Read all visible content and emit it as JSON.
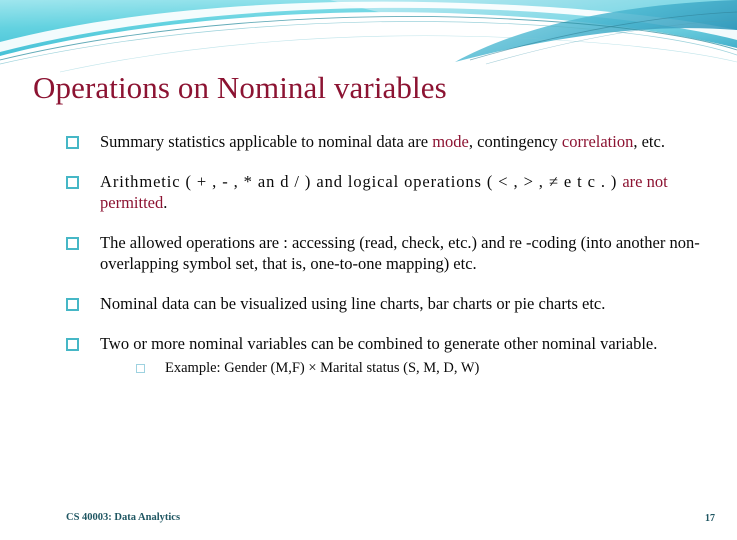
{
  "slide": {
    "title": "Operations on Nominal variables",
    "accent_color": "#8C1332",
    "bullet_color": "#46B7C6",
    "footer_color": "#1F5662",
    "header_gradient_start": "#6FD8E4",
    "header_gradient_end": "#3FA9C4"
  },
  "bullets": [
    {
      "marker": "hollow-square",
      "parts": [
        {
          "text": "Summary  statistics  applicable  to  nominal  data  are  ",
          "style": "normal"
        },
        {
          "text": "mode",
          "style": "accent"
        },
        {
          "text": ", contingency ",
          "style": "normal"
        },
        {
          "text": "correlation",
          "style": "accent"
        },
        {
          "text": ", etc.",
          "style": "normal"
        }
      ]
    },
    {
      "marker": "hollow-square",
      "parts": [
        {
          "text": "Arithmetic ( + , - , * an d / )  and logical operations ( < , > , ≠  e t c . ) ",
          "style": "ops"
        },
        {
          "text": "are not permitted",
          "style": "accent"
        },
        {
          "text": ".",
          "style": "normal"
        }
      ]
    },
    {
      "marker": "hollow-square",
      "parts": [
        {
          "text": "The allowed operations are : accessing (read, check, etc.) and re -coding (into another non-overlapping symbol set, that is,  one-to-one mapping) etc.",
          "style": "normal"
        }
      ]
    },
    {
      "marker": "hollow-square",
      "parts": [
        {
          "text": "Nominal data can be visualized using line charts, bar charts or pie charts etc.",
          "style": "normal"
        }
      ]
    },
    {
      "marker": "hollow-square",
      "parts": [
        {
          "text": "Two  or  more  nominal  variables  can  be  combined  to  generate other nominal variable.",
          "style": "normal"
        }
      ],
      "sub": {
        "marker": "hollow-square-small",
        "text": "Example: Gender (M,F) × Marital status (S, M, D, W)"
      }
    }
  ],
  "footer": {
    "course": "CS 40003: Data Analytics",
    "page_number": "17"
  }
}
